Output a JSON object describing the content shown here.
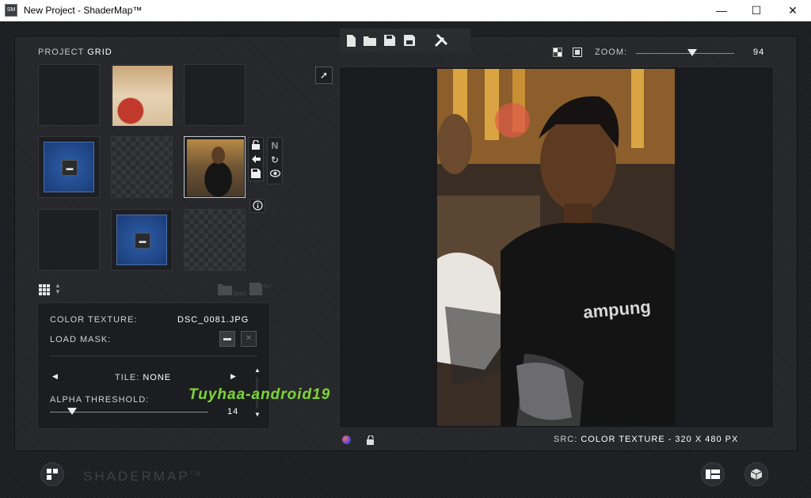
{
  "window": {
    "app_icon_text": "SM",
    "title": "New Project - ShaderMap™",
    "minimize": "—",
    "maximize": "☐",
    "close": "✕"
  },
  "toolbar": {
    "new_icon": "new-file-icon",
    "open_icon": "open-folder-icon",
    "save_icon": "save-icon",
    "save_as_icon": "save-as-icon",
    "settings_icon": "wrench-screwdriver-icon"
  },
  "grid": {
    "label_prefix": "PROJECT",
    "label_strong": "GRID",
    "bake_label": "BAKE",
    "all_label": "ALL"
  },
  "preview": {
    "zoom_label": "ZOOM:",
    "zoom_value": "94",
    "zoom_fraction": 0.57,
    "src_prefix": "SRC:",
    "src_value": "COLOR TEXTURE  -  320 X 480 PX"
  },
  "panel": {
    "color_texture_label": "COLOR TEXTURE:",
    "color_texture_value": "DSC_0081.JPG",
    "load_mask_label": "LOAD MASK:",
    "tile_prefix": "TILE:",
    "tile_value": "NONE",
    "alpha_label": "ALPHA THRESHOLD:",
    "alpha_value": "14",
    "alpha_fraction": 0.14
  },
  "side_icons": {
    "strip1": [
      "lock-icon",
      "arrow-left-icon",
      "save-icon"
    ],
    "strip2": [
      "normal-map-icon",
      "refresh-icon",
      "eye-icon"
    ],
    "info": "info-icon"
  },
  "bottom": {
    "brand": "SHADERMAP",
    "brand_tm": "TM"
  },
  "watermark": "Tuyhaa-android19"
}
